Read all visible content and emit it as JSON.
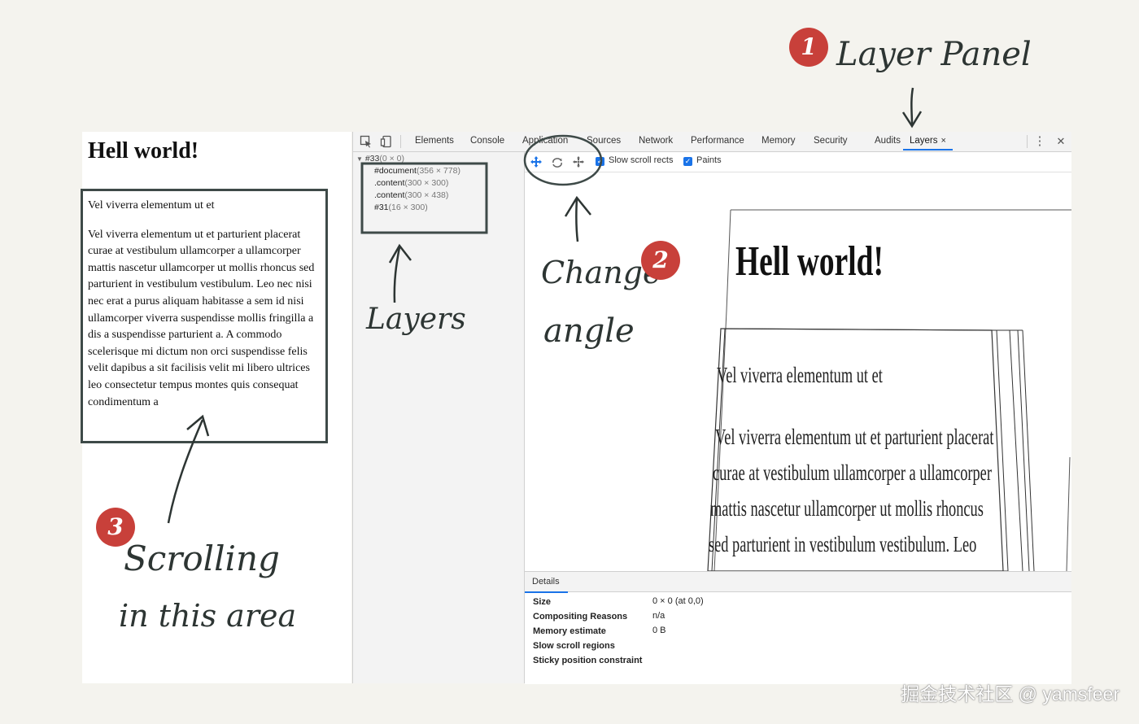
{
  "left_page": {
    "heading": "Hell world!",
    "para_short": "Vel viverra elementum ut et",
    "para_long": "Vel viverra elementum ut et parturient placerat curae at vestibulum ullamcorper a ullamcorper mattis nascetur ullamcorper ut mollis rhoncus sed parturient in vestibulum vestibulum. Leo nec nisi nec erat a purus aliquam habitasse a sem id nisi ullamcorper viverra suspendisse mollis fringilla a dis a suspendisse parturient a. A commodo scelerisque mi dictum non orci suspendisse felis velit dapibus a sit facilisis velit mi libero ultrices leo consectetur tempus montes quis consequat condimentum a"
  },
  "devtools": {
    "tabs": [
      "Elements",
      "Console",
      "Application",
      "Sources",
      "Network",
      "Performance",
      "Memory",
      "Security",
      "Audits"
    ],
    "active_tab": "Layers",
    "close_symbol": "×",
    "menu_symbol": "⋮",
    "window_close_symbol": "✕"
  },
  "layers": {
    "root": {
      "name": "#33",
      "size": "(0 × 0)"
    },
    "items": [
      {
        "name": "#document",
        "size": "(356 × 778)"
      },
      {
        "name": ".content",
        "size": "(300 × 300)"
      },
      {
        "name": ".content",
        "size": "(300 × 438)"
      },
      {
        "name": "#31",
        "size": "(16 × 300)"
      }
    ]
  },
  "layers_toolbar": {
    "slow_scroll_label": "Slow scroll rects",
    "slow_scroll_checked": true,
    "paints_label": "Paints",
    "paints_checked": true
  },
  "viewport": {
    "heading": "Hell world!",
    "lines": [
      "Vel viverra elementum ut et",
      "Vel viverra elementum ut et parturient placerat",
      "curae at vestibulum ullamcorper a ullamcorper",
      "mattis nascetur ullamcorper ut mollis rhoncus",
      "sed parturient in vestibulum vestibulum. Leo"
    ]
  },
  "details": {
    "tab_label": "Details",
    "rows": [
      {
        "label": "Size",
        "value": "0 × 0 (at 0,0)"
      },
      {
        "label": "Compositing Reasons",
        "value": "n/a"
      },
      {
        "label": "Memory estimate",
        "value": "0 B"
      },
      {
        "label": "Slow scroll regions",
        "value": ""
      },
      {
        "label": "Sticky position constraint",
        "value": ""
      }
    ]
  },
  "annotations": {
    "badge1": "1",
    "badge1_text": "Layer Panel",
    "badge2": "2",
    "badge2_line1": "Change",
    "badge2_line2": "angle",
    "badge3": "3",
    "badge3_line1": "Scrolling",
    "badge3_line2": "in this area",
    "layers_text": "Layers"
  },
  "watermark": "掘金技术社区 @ yamsfeer",
  "colors": {
    "accent": "#1a73e8",
    "badge": "#c8403a",
    "ink": "#2d3533",
    "background": "#f4f3ee"
  }
}
